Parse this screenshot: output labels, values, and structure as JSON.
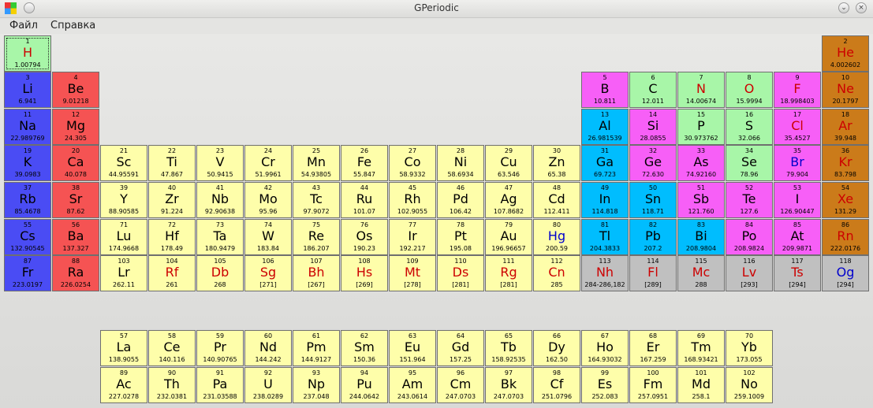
{
  "window": {
    "title": "GPeriodic"
  },
  "menu": [
    {
      "label": "Файл"
    },
    {
      "label": "Справка"
    }
  ],
  "colors": {
    "alkali": "#4a4cf4",
    "alkaline": "#f55353",
    "transition": "#fefeaa",
    "post": "#00bdfe",
    "metalloid": "#a8f6a8",
    "nonmetal": "#f75ff7",
    "noble": "#cb7b1a",
    "unknown": "#c0c0c0",
    "text_black": "#000000",
    "text_red": "#cc0000",
    "text_blue": "#0000cc"
  },
  "elements": [
    {
      "n": "1",
      "s": "H",
      "m": "1.00794",
      "cat": "metalloid",
      "tc": "red"
    },
    {
      "n": "2",
      "s": "He",
      "m": "4.002602",
      "cat": "noble",
      "tc": "red"
    },
    {
      "n": "3",
      "s": "Li",
      "m": "6.941",
      "cat": "alkali",
      "tc": "black"
    },
    {
      "n": "4",
      "s": "Be",
      "m": "9.01218",
      "cat": "alkaline",
      "tc": "black"
    },
    {
      "n": "5",
      "s": "B",
      "m": "10.811",
      "cat": "nonmetal",
      "tc": "black"
    },
    {
      "n": "6",
      "s": "C",
      "m": "12.011",
      "cat": "metalloid",
      "tc": "black"
    },
    {
      "n": "7",
      "s": "N",
      "m": "14.00674",
      "cat": "metalloid",
      "tc": "red"
    },
    {
      "n": "8",
      "s": "O",
      "m": "15.9994",
      "cat": "metalloid",
      "tc": "red"
    },
    {
      "n": "9",
      "s": "F",
      "m": "18.998403",
      "cat": "nonmetal",
      "tc": "red"
    },
    {
      "n": "10",
      "s": "Ne",
      "m": "20.1797",
      "cat": "noble",
      "tc": "red"
    },
    {
      "n": "11",
      "s": "Na",
      "m": "22.989769",
      "cat": "alkali",
      "tc": "black"
    },
    {
      "n": "12",
      "s": "Mg",
      "m": "24.305",
      "cat": "alkaline",
      "tc": "black"
    },
    {
      "n": "13",
      "s": "Al",
      "m": "26.981539",
      "cat": "post",
      "tc": "black"
    },
    {
      "n": "14",
      "s": "Si",
      "m": "28.0855",
      "cat": "nonmetal",
      "tc": "black"
    },
    {
      "n": "15",
      "s": "P",
      "m": "30.973762",
      "cat": "metalloid",
      "tc": "black"
    },
    {
      "n": "16",
      "s": "S",
      "m": "32.066",
      "cat": "metalloid",
      "tc": "black"
    },
    {
      "n": "17",
      "s": "Cl",
      "m": "35.4527",
      "cat": "nonmetal",
      "tc": "red"
    },
    {
      "n": "18",
      "s": "Ar",
      "m": "39.948",
      "cat": "noble",
      "tc": "red"
    },
    {
      "n": "19",
      "s": "K",
      "m": "39.0983",
      "cat": "alkali",
      "tc": "black"
    },
    {
      "n": "20",
      "s": "Ca",
      "m": "40.078",
      "cat": "alkaline",
      "tc": "black"
    },
    {
      "n": "21",
      "s": "Sc",
      "m": "44.95591",
      "cat": "transition",
      "tc": "black"
    },
    {
      "n": "22",
      "s": "Ti",
      "m": "47.867",
      "cat": "transition",
      "tc": "black"
    },
    {
      "n": "23",
      "s": "V",
      "m": "50.9415",
      "cat": "transition",
      "tc": "black"
    },
    {
      "n": "24",
      "s": "Cr",
      "m": "51.9961",
      "cat": "transition",
      "tc": "black"
    },
    {
      "n": "25",
      "s": "Mn",
      "m": "54.93805",
      "cat": "transition",
      "tc": "black"
    },
    {
      "n": "26",
      "s": "Fe",
      "m": "55.847",
      "cat": "transition",
      "tc": "black"
    },
    {
      "n": "27",
      "s": "Co",
      "m": "58.9332",
      "cat": "transition",
      "tc": "black"
    },
    {
      "n": "28",
      "s": "Ni",
      "m": "58.6934",
      "cat": "transition",
      "tc": "black"
    },
    {
      "n": "29",
      "s": "Cu",
      "m": "63.546",
      "cat": "transition",
      "tc": "black"
    },
    {
      "n": "30",
      "s": "Zn",
      "m": "65.38",
      "cat": "transition",
      "tc": "black"
    },
    {
      "n": "31",
      "s": "Ga",
      "m": "69.723",
      "cat": "post",
      "tc": "black"
    },
    {
      "n": "32",
      "s": "Ge",
      "m": "72.630",
      "cat": "nonmetal",
      "tc": "black"
    },
    {
      "n": "33",
      "s": "As",
      "m": "74.92160",
      "cat": "nonmetal",
      "tc": "black"
    },
    {
      "n": "34",
      "s": "Se",
      "m": "78.96",
      "cat": "metalloid",
      "tc": "black"
    },
    {
      "n": "35",
      "s": "Br",
      "m": "79.904",
      "cat": "nonmetal",
      "tc": "blue"
    },
    {
      "n": "36",
      "s": "Kr",
      "m": "83.798",
      "cat": "noble",
      "tc": "red"
    },
    {
      "n": "37",
      "s": "Rb",
      "m": "85.4678",
      "cat": "alkali",
      "tc": "black"
    },
    {
      "n": "38",
      "s": "Sr",
      "m": "87.62",
      "cat": "alkaline",
      "tc": "black"
    },
    {
      "n": "39",
      "s": "Y",
      "m": "88.90585",
      "cat": "transition",
      "tc": "black"
    },
    {
      "n": "40",
      "s": "Zr",
      "m": "91.224",
      "cat": "transition",
      "tc": "black"
    },
    {
      "n": "41",
      "s": "Nb",
      "m": "92.90638",
      "cat": "transition",
      "tc": "black"
    },
    {
      "n": "42",
      "s": "Mo",
      "m": "95.96",
      "cat": "transition",
      "tc": "black"
    },
    {
      "n": "43",
      "s": "Tc",
      "m": "97.9072",
      "cat": "transition",
      "tc": "black"
    },
    {
      "n": "44",
      "s": "Ru",
      "m": "101.07",
      "cat": "transition",
      "tc": "black"
    },
    {
      "n": "45",
      "s": "Rh",
      "m": "102.9055",
      "cat": "transition",
      "tc": "black"
    },
    {
      "n": "46",
      "s": "Pd",
      "m": "106.42",
      "cat": "transition",
      "tc": "black"
    },
    {
      "n": "47",
      "s": "Ag",
      "m": "107.8682",
      "cat": "transition",
      "tc": "black"
    },
    {
      "n": "48",
      "s": "Cd",
      "m": "112.411",
      "cat": "transition",
      "tc": "black"
    },
    {
      "n": "49",
      "s": "In",
      "m": "114.818",
      "cat": "post",
      "tc": "black"
    },
    {
      "n": "50",
      "s": "Sn",
      "m": "118.71",
      "cat": "post",
      "tc": "black"
    },
    {
      "n": "51",
      "s": "Sb",
      "m": "121.760",
      "cat": "nonmetal",
      "tc": "black"
    },
    {
      "n": "52",
      "s": "Te",
      "m": "127.6",
      "cat": "nonmetal",
      "tc": "black"
    },
    {
      "n": "53",
      "s": "I",
      "m": "126.90447",
      "cat": "nonmetal",
      "tc": "black"
    },
    {
      "n": "54",
      "s": "Xe",
      "m": "131.29",
      "cat": "noble",
      "tc": "red"
    },
    {
      "n": "55",
      "s": "Cs",
      "m": "132.90545",
      "cat": "alkali",
      "tc": "black"
    },
    {
      "n": "56",
      "s": "Ba",
      "m": "137.327",
      "cat": "alkaline",
      "tc": "black"
    },
    {
      "n": "71",
      "s": "Lu",
      "m": "174.9668",
      "cat": "transition",
      "tc": "black"
    },
    {
      "n": "72",
      "s": "Hf",
      "m": "178.49",
      "cat": "transition",
      "tc": "black"
    },
    {
      "n": "73",
      "s": "Ta",
      "m": "180.9479",
      "cat": "transition",
      "tc": "black"
    },
    {
      "n": "74",
      "s": "W",
      "m": "183.84",
      "cat": "transition",
      "tc": "black"
    },
    {
      "n": "75",
      "s": "Re",
      "m": "186.207",
      "cat": "transition",
      "tc": "black"
    },
    {
      "n": "76",
      "s": "Os",
      "m": "190.23",
      "cat": "transition",
      "tc": "black"
    },
    {
      "n": "77",
      "s": "Ir",
      "m": "192.217",
      "cat": "transition",
      "tc": "black"
    },
    {
      "n": "78",
      "s": "Pt",
      "m": "195.08",
      "cat": "transition",
      "tc": "black"
    },
    {
      "n": "79",
      "s": "Au",
      "m": "196.96657",
      "cat": "transition",
      "tc": "black"
    },
    {
      "n": "80",
      "s": "Hg",
      "m": "200.59",
      "cat": "transition",
      "tc": "blue"
    },
    {
      "n": "81",
      "s": "Tl",
      "m": "204.3833",
      "cat": "post",
      "tc": "black"
    },
    {
      "n": "82",
      "s": "Pb",
      "m": "207.2",
      "cat": "post",
      "tc": "black"
    },
    {
      "n": "83",
      "s": "Bi",
      "m": "208.9804",
      "cat": "post",
      "tc": "black"
    },
    {
      "n": "84",
      "s": "Po",
      "m": "208.9824",
      "cat": "nonmetal",
      "tc": "black"
    },
    {
      "n": "85",
      "s": "At",
      "m": "209.9871",
      "cat": "nonmetal",
      "tc": "black"
    },
    {
      "n": "86",
      "s": "Rn",
      "m": "222.0176",
      "cat": "noble",
      "tc": "red"
    },
    {
      "n": "87",
      "s": "Fr",
      "m": "223.0197",
      "cat": "alkali",
      "tc": "black"
    },
    {
      "n": "88",
      "s": "Ra",
      "m": "226.0254",
      "cat": "alkaline",
      "tc": "black"
    },
    {
      "n": "103",
      "s": "Lr",
      "m": "262.11",
      "cat": "transition",
      "tc": "black"
    },
    {
      "n": "104",
      "s": "Rf",
      "m": "261",
      "cat": "transition",
      "tc": "red"
    },
    {
      "n": "105",
      "s": "Db",
      "m": "268",
      "cat": "transition",
      "tc": "red"
    },
    {
      "n": "106",
      "s": "Sg",
      "m": "[271]",
      "cat": "transition",
      "tc": "red"
    },
    {
      "n": "107",
      "s": "Bh",
      "m": "[267]",
      "cat": "transition",
      "tc": "red"
    },
    {
      "n": "108",
      "s": "Hs",
      "m": "[269]",
      "cat": "transition",
      "tc": "red"
    },
    {
      "n": "109",
      "s": "Mt",
      "m": "[278]",
      "cat": "transition",
      "tc": "red"
    },
    {
      "n": "110",
      "s": "Ds",
      "m": "[281]",
      "cat": "transition",
      "tc": "red"
    },
    {
      "n": "111",
      "s": "Rg",
      "m": "[281]",
      "cat": "transition",
      "tc": "red"
    },
    {
      "n": "112",
      "s": "Cn",
      "m": "285",
      "cat": "transition",
      "tc": "red"
    },
    {
      "n": "113",
      "s": "Nh",
      "m": "284-286,182",
      "cat": "unknown",
      "tc": "red"
    },
    {
      "n": "114",
      "s": "Fl",
      "m": "[289]",
      "cat": "unknown",
      "tc": "red"
    },
    {
      "n": "115",
      "s": "Mc",
      "m": "288",
      "cat": "unknown",
      "tc": "red"
    },
    {
      "n": "116",
      "s": "Lv",
      "m": "[293]",
      "cat": "unknown",
      "tc": "red"
    },
    {
      "n": "117",
      "s": "Ts",
      "m": "[294]",
      "cat": "unknown",
      "tc": "red"
    },
    {
      "n": "118",
      "s": "Og",
      "m": "[294]",
      "cat": "unknown",
      "tc": "blue"
    },
    {
      "n": "57",
      "s": "La",
      "m": "138.9055",
      "cat": "transition",
      "tc": "black"
    },
    {
      "n": "58",
      "s": "Ce",
      "m": "140.116",
      "cat": "transition",
      "tc": "black"
    },
    {
      "n": "59",
      "s": "Pr",
      "m": "140.90765",
      "cat": "transition",
      "tc": "black"
    },
    {
      "n": "60",
      "s": "Nd",
      "m": "144.242",
      "cat": "transition",
      "tc": "black"
    },
    {
      "n": "61",
      "s": "Pm",
      "m": "144.9127",
      "cat": "transition",
      "tc": "black"
    },
    {
      "n": "62",
      "s": "Sm",
      "m": "150.36",
      "cat": "transition",
      "tc": "black"
    },
    {
      "n": "63",
      "s": "Eu",
      "m": "151.964",
      "cat": "transition",
      "tc": "black"
    },
    {
      "n": "64",
      "s": "Gd",
      "m": "157.25",
      "cat": "transition",
      "tc": "black"
    },
    {
      "n": "65",
      "s": "Tb",
      "m": "158.92535",
      "cat": "transition",
      "tc": "black"
    },
    {
      "n": "66",
      "s": "Dy",
      "m": "162.50",
      "cat": "transition",
      "tc": "black"
    },
    {
      "n": "67",
      "s": "Ho",
      "m": "164.93032",
      "cat": "transition",
      "tc": "black"
    },
    {
      "n": "68",
      "s": "Er",
      "m": "167.259",
      "cat": "transition",
      "tc": "black"
    },
    {
      "n": "69",
      "s": "Tm",
      "m": "168.93421",
      "cat": "transition",
      "tc": "black"
    },
    {
      "n": "70",
      "s": "Yb",
      "m": "173.055",
      "cat": "transition",
      "tc": "black"
    },
    {
      "n": "89",
      "s": "Ac",
      "m": "227.0278",
      "cat": "transition",
      "tc": "black"
    },
    {
      "n": "90",
      "s": "Th",
      "m": "232.0381",
      "cat": "transition",
      "tc": "black"
    },
    {
      "n": "91",
      "s": "Pa",
      "m": "231.03588",
      "cat": "transition",
      "tc": "black"
    },
    {
      "n": "92",
      "s": "U",
      "m": "238.0289",
      "cat": "transition",
      "tc": "black"
    },
    {
      "n": "93",
      "s": "Np",
      "m": "237.048",
      "cat": "transition",
      "tc": "black"
    },
    {
      "n": "94",
      "s": "Pu",
      "m": "244.0642",
      "cat": "transition",
      "tc": "black"
    },
    {
      "n": "95",
      "s": "Am",
      "m": "243.0614",
      "cat": "transition",
      "tc": "black"
    },
    {
      "n": "96",
      "s": "Cm",
      "m": "247.0703",
      "cat": "transition",
      "tc": "black"
    },
    {
      "n": "97",
      "s": "Bk",
      "m": "247.0703",
      "cat": "transition",
      "tc": "black"
    },
    {
      "n": "98",
      "s": "Cf",
      "m": "251.0796",
      "cat": "transition",
      "tc": "black"
    },
    {
      "n": "99",
      "s": "Es",
      "m": "252.083",
      "cat": "transition",
      "tc": "black"
    },
    {
      "n": "100",
      "s": "Fm",
      "m": "257.0951",
      "cat": "transition",
      "tc": "black"
    },
    {
      "n": "101",
      "s": "Md",
      "m": "258.1",
      "cat": "transition",
      "tc": "black"
    },
    {
      "n": "102",
      "s": "No",
      "m": "259.1009",
      "cat": "transition",
      "tc": "black"
    }
  ]
}
